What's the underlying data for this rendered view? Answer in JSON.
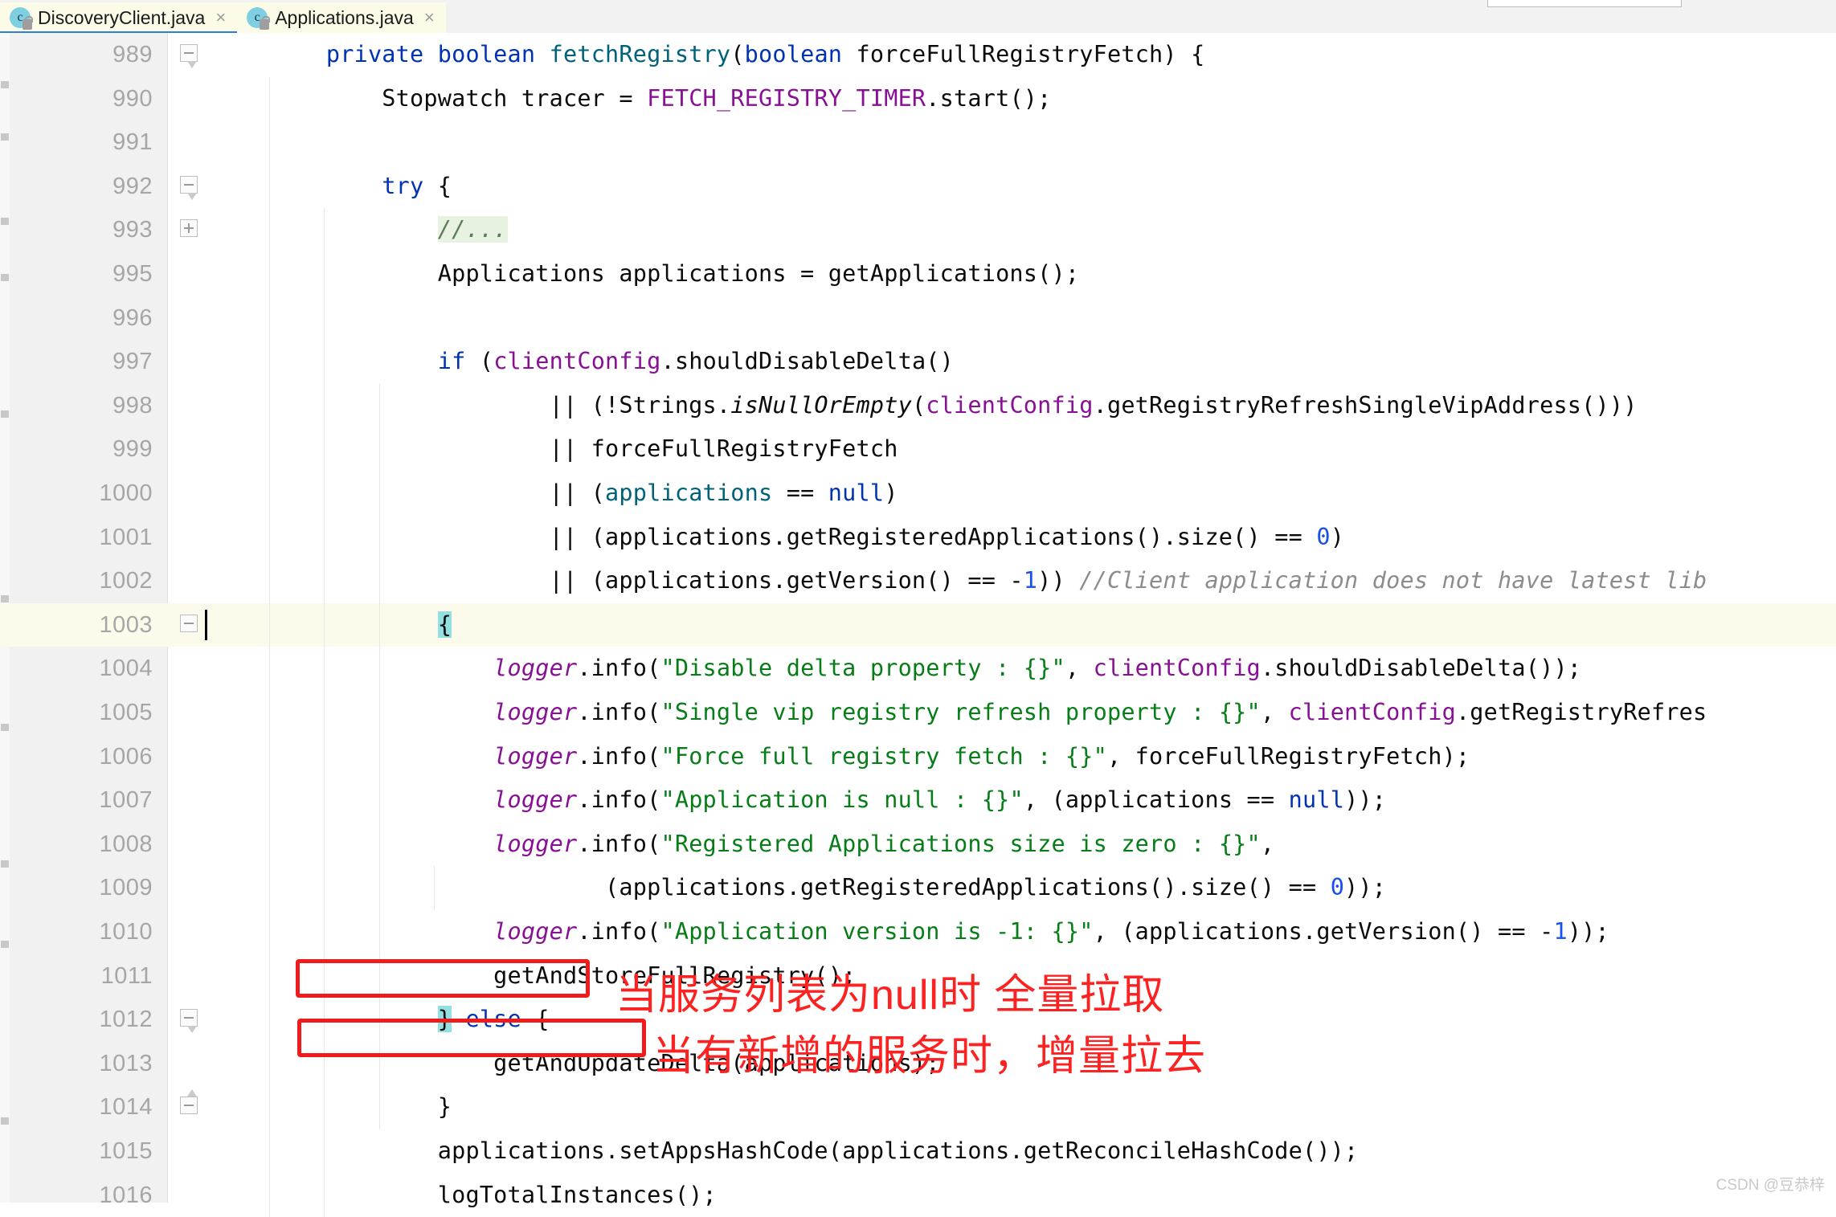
{
  "window": {
    "app": "IntelliJ IDEA Java Editor"
  },
  "tabs": [
    {
      "label": "DiscoveryClient.java",
      "icon": "java-class-icon",
      "active": true,
      "close": "×"
    },
    {
      "label": "Applications.java",
      "icon": "java-class-icon",
      "active": false,
      "close": "×"
    }
  ],
  "editor": {
    "current_line": 1003,
    "lines": [
      {
        "no": "989",
        "fold": "minus-tail-down",
        "indent_guides": [],
        "tokens": [
          {
            "t": "        ",
            "c": ""
          },
          {
            "t": "private",
            "c": "kw"
          },
          {
            "t": " ",
            "c": ""
          },
          {
            "t": "boolean",
            "c": "kw"
          },
          {
            "t": " ",
            "c": ""
          },
          {
            "t": "fetchRegistry",
            "c": "mth"
          },
          {
            "t": "(",
            "c": ""
          },
          {
            "t": "boolean",
            "c": "kw"
          },
          {
            "t": " forceFullRegistryFetch) {",
            "c": ""
          }
        ]
      },
      {
        "no": "990",
        "fold": "",
        "indent_guides": [
          1
        ],
        "tokens": [
          {
            "t": "            Stopwatch tracer = ",
            "c": ""
          },
          {
            "t": "FETCH_REGISTRY_TIMER",
            "c": "cst"
          },
          {
            "t": ".start();",
            "c": ""
          }
        ]
      },
      {
        "no": "991",
        "fold": "",
        "indent_guides": [
          1
        ],
        "tokens": []
      },
      {
        "no": "992",
        "fold": "minus-tail-down",
        "indent_guides": [
          1
        ],
        "tokens": [
          {
            "t": "            ",
            "c": ""
          },
          {
            "t": "try",
            "c": "kw"
          },
          {
            "t": " {",
            "c": ""
          }
        ]
      },
      {
        "no": "993",
        "fold": "plus",
        "indent_guides": [
          1,
          2
        ],
        "tokens": [
          {
            "t": "                ",
            "c": ""
          },
          {
            "t": "//...",
            "c": "cmt-green"
          }
        ]
      },
      {
        "no": "995",
        "fold": "",
        "indent_guides": [
          1,
          2
        ],
        "tokens": [
          {
            "t": "                Applications applications = getApplications();",
            "c": ""
          }
        ]
      },
      {
        "no": "996",
        "fold": "",
        "indent_guides": [
          1,
          2
        ],
        "tokens": []
      },
      {
        "no": "997",
        "fold": "",
        "indent_guides": [
          1,
          2
        ],
        "tokens": [
          {
            "t": "                ",
            "c": ""
          },
          {
            "t": "if",
            "c": "kw"
          },
          {
            "t": " (",
            "c": ""
          },
          {
            "t": "clientConfig",
            "c": "fld"
          },
          {
            "t": ".shouldDisableDelta()",
            "c": ""
          }
        ]
      },
      {
        "no": "998",
        "fold": "",
        "indent_guides": [
          1,
          2,
          3
        ],
        "tokens": [
          {
            "t": "                        || (!Strings.",
            "c": ""
          },
          {
            "t": "isNullOrEmpty",
            "c": "stat-i"
          },
          {
            "t": "(",
            "c": ""
          },
          {
            "t": "clientConfig",
            "c": "fld"
          },
          {
            "t": ".getRegistryRefreshSingleVipAddress()))",
            "c": ""
          }
        ]
      },
      {
        "no": "999",
        "fold": "",
        "indent_guides": [
          1,
          2,
          3
        ],
        "tokens": [
          {
            "t": "                        || forceFullRegistryFetch",
            "c": ""
          }
        ]
      },
      {
        "no": "1000",
        "fold": "",
        "indent_guides": [
          1,
          2,
          3
        ],
        "tokens": [
          {
            "t": "                        || (",
            "c": ""
          },
          {
            "t": "applications",
            "c": "mth"
          },
          {
            "t": " == ",
            "c": ""
          },
          {
            "t": "null",
            "c": "kw"
          },
          {
            "t": ")",
            "c": ""
          }
        ]
      },
      {
        "no": "1001",
        "fold": "",
        "indent_guides": [
          1,
          2,
          3
        ],
        "tokens": [
          {
            "t": "                        || (applications.getRegisteredApplications().size() == ",
            "c": ""
          },
          {
            "t": "0",
            "c": "num"
          },
          {
            "t": ")",
            "c": ""
          }
        ]
      },
      {
        "no": "1002",
        "fold": "",
        "indent_guides": [
          1,
          2,
          3
        ],
        "tokens": [
          {
            "t": "                        || (applications.getVersion() == -",
            "c": ""
          },
          {
            "t": "1",
            "c": "num"
          },
          {
            "t": ")) ",
            "c": ""
          },
          {
            "t": "//Client application does not have latest lib",
            "c": "cmt"
          }
        ]
      },
      {
        "no": "1003",
        "fold": "minus",
        "current": true,
        "caret": true,
        "indent_guides": [
          1,
          2,
          3
        ],
        "tokens": [
          {
            "t": "                ",
            "c": ""
          },
          {
            "t": "{",
            "c": "brace-hl"
          }
        ]
      },
      {
        "no": "1004",
        "fold": "",
        "indent_guides": [
          1,
          2,
          3
        ],
        "tokens": [
          {
            "t": "                    ",
            "c": ""
          },
          {
            "t": "logger",
            "c": "fldi"
          },
          {
            "t": ".info(",
            "c": ""
          },
          {
            "t": "\"Disable delta property : {}\"",
            "c": "str"
          },
          {
            "t": ", ",
            "c": ""
          },
          {
            "t": "clientConfig",
            "c": "fld"
          },
          {
            "t": ".shouldDisableDelta());",
            "c": ""
          }
        ]
      },
      {
        "no": "1005",
        "fold": "",
        "indent_guides": [
          1,
          2,
          3
        ],
        "tokens": [
          {
            "t": "                    ",
            "c": ""
          },
          {
            "t": "logger",
            "c": "fldi"
          },
          {
            "t": ".info(",
            "c": ""
          },
          {
            "t": "\"Single vip registry refresh property : {}\"",
            "c": "str"
          },
          {
            "t": ", ",
            "c": ""
          },
          {
            "t": "clientConfig",
            "c": "fld"
          },
          {
            "t": ".getRegistryRefres",
            "c": ""
          }
        ]
      },
      {
        "no": "1006",
        "fold": "",
        "indent_guides": [
          1,
          2,
          3
        ],
        "tokens": [
          {
            "t": "                    ",
            "c": ""
          },
          {
            "t": "logger",
            "c": "fldi"
          },
          {
            "t": ".info(",
            "c": ""
          },
          {
            "t": "\"Force full registry fetch : {}\"",
            "c": "str"
          },
          {
            "t": ", forceFullRegistryFetch);",
            "c": ""
          }
        ]
      },
      {
        "no": "1007",
        "fold": "",
        "indent_guides": [
          1,
          2,
          3
        ],
        "tokens": [
          {
            "t": "                    ",
            "c": ""
          },
          {
            "t": "logger",
            "c": "fldi"
          },
          {
            "t": ".info(",
            "c": ""
          },
          {
            "t": "\"Application is null : {}\"",
            "c": "str"
          },
          {
            "t": ", (applications == ",
            "c": ""
          },
          {
            "t": "null",
            "c": "kw"
          },
          {
            "t": "));",
            "c": ""
          }
        ]
      },
      {
        "no": "1008",
        "fold": "",
        "indent_guides": [
          1,
          2,
          3
        ],
        "tokens": [
          {
            "t": "                    ",
            "c": ""
          },
          {
            "t": "logger",
            "c": "fldi"
          },
          {
            "t": ".info(",
            "c": ""
          },
          {
            "t": "\"Registered Applications size is zero : {}\"",
            "c": "str"
          },
          {
            "t": ",",
            "c": ""
          }
        ]
      },
      {
        "no": "1009",
        "fold": "",
        "indent_guides": [
          1,
          2,
          3,
          4
        ],
        "tokens": [
          {
            "t": "                            (applications.getRegisteredApplications().size() == ",
            "c": ""
          },
          {
            "t": "0",
            "c": "num"
          },
          {
            "t": "));",
            "c": ""
          }
        ]
      },
      {
        "no": "1010",
        "fold": "",
        "indent_guides": [
          1,
          2,
          3
        ],
        "tokens": [
          {
            "t": "                    ",
            "c": ""
          },
          {
            "t": "logger",
            "c": "fldi"
          },
          {
            "t": ".info(",
            "c": ""
          },
          {
            "t": "\"Application version is -1: {}\"",
            "c": "str"
          },
          {
            "t": ", (applications.getVersion() == -",
            "c": ""
          },
          {
            "t": "1",
            "c": "num"
          },
          {
            "t": "));",
            "c": ""
          }
        ]
      },
      {
        "no": "1011",
        "fold": "",
        "indent_guides": [
          1,
          2,
          3
        ],
        "tokens": [
          {
            "t": "                    getAndStoreFullRegistry();",
            "c": ""
          }
        ]
      },
      {
        "no": "1012",
        "fold": "minus-tail-down",
        "indent_guides": [
          1,
          2,
          3
        ],
        "tokens": [
          {
            "t": "                ",
            "c": ""
          },
          {
            "t": "}",
            "c": "brace-hl"
          },
          {
            "t": " ",
            "c": ""
          },
          {
            "t": "else",
            "c": "kw"
          },
          {
            "t": " {",
            "c": ""
          }
        ]
      },
      {
        "no": "1013",
        "fold": "",
        "indent_guides": [
          1,
          2,
          3
        ],
        "tokens": [
          {
            "t": "                    getAndUpdateDelta(applications);",
            "c": ""
          }
        ]
      },
      {
        "no": "1014",
        "fold": "minus-tail-up",
        "indent_guides": [
          1,
          2,
          3
        ],
        "tokens": [
          {
            "t": "                }",
            "c": ""
          }
        ]
      },
      {
        "no": "1015",
        "fold": "",
        "indent_guides": [
          1,
          2
        ],
        "tokens": [
          {
            "t": "                applications.setAppsHashCode(applications.getReconcileHashCode());",
            "c": ""
          }
        ]
      },
      {
        "no": "1016",
        "fold": "",
        "indent_guides": [
          1,
          2
        ],
        "tokens": [
          {
            "t": "                logTotalInstances();",
            "c": ""
          }
        ]
      }
    ]
  },
  "annotations": [
    {
      "id": "full-fetch",
      "box_target": "getAndStoreFullRegistry();",
      "text": "当服务列表为null时 全量拉取",
      "color": "#fb2222"
    },
    {
      "id": "delta-fetch",
      "box_target": "getAndUpdateDelta(applications);",
      "text": "当有新增的服务时，增量拉去",
      "color": "#fb2222"
    }
  ],
  "watermark": "CSDN @豆恭梓",
  "colors": {
    "keyword": "#0033b3",
    "method": "#00627a",
    "field": "#871094",
    "string": "#067d17",
    "number": "#1750eb",
    "comment": "#8c8c8c",
    "annotation_red": "#fb2222",
    "tab_active_bg": "#fcfbe8",
    "tab_underline": "#2f7fd0",
    "current_line_bg": "#fcfbeb",
    "brace_match": "#93e0e3"
  }
}
